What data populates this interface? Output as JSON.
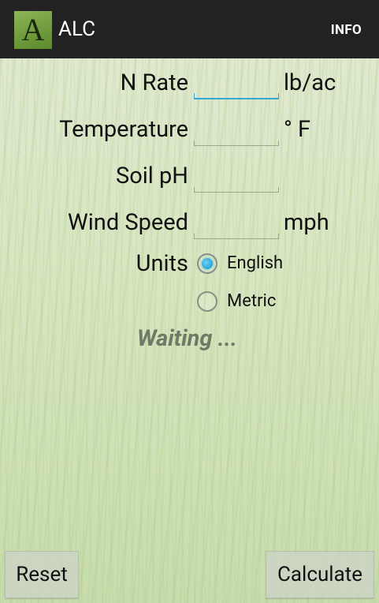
{
  "actionbar": {
    "icon_letter": "A",
    "title": "ALC",
    "info_label": "INFO"
  },
  "form": {
    "n_rate": {
      "label": "N Rate",
      "value": "",
      "unit": "lb/ac"
    },
    "temperature": {
      "label": "Temperature",
      "value": "",
      "unit": "° F"
    },
    "soil_ph": {
      "label": "Soil pH",
      "value": ""
    },
    "wind_speed": {
      "label": "Wind Speed",
      "value": "",
      "unit": "mph"
    },
    "units": {
      "label": "Units",
      "options": [
        {
          "label": "English",
          "selected": true
        },
        {
          "label": "Metric",
          "selected": false
        }
      ]
    }
  },
  "status": {
    "text": "Waiting ..."
  },
  "buttons": {
    "reset_label": "Reset",
    "calculate_label": "Calculate"
  },
  "colors": {
    "accent": "#33a9d6",
    "actionbar_bg": "#222222",
    "status_text": "#6f7a66"
  }
}
